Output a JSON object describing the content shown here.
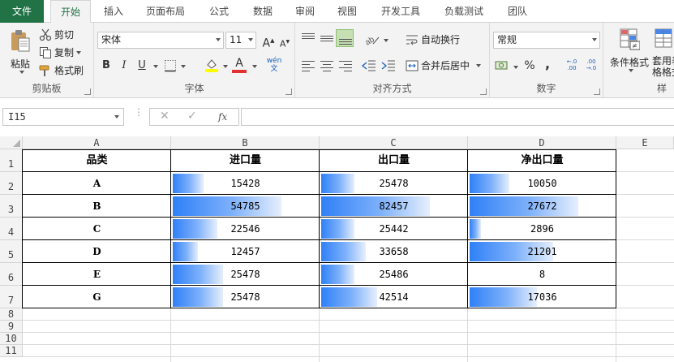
{
  "tabs": [
    "文件",
    "开始",
    "插入",
    "页面布局",
    "公式",
    "数据",
    "审阅",
    "视图",
    "开发工具",
    "负载测试",
    "团队"
  ],
  "active_tab": "开始",
  "ribbon": {
    "clipboard": {
      "label": "剪贴板",
      "paste": "粘贴",
      "cut": "剪切",
      "copy": "复制",
      "format_painter": "格式刷"
    },
    "font": {
      "label": "字体",
      "font_name": "宋体",
      "font_size": "11",
      "bold": "B",
      "italic": "I",
      "underline": "U",
      "grow": "A",
      "shrink": "A",
      "phonetic": "wén 文",
      "font_color_label": "A"
    },
    "alignment": {
      "label": "对齐方式",
      "wrap_text": "自动换行",
      "merge_center": "合并后居中"
    },
    "number": {
      "label": "数字",
      "format": "常规",
      "percent": "%",
      "comma": ",",
      "inc_decimal": "←.0 .00",
      "dec_decimal": ".00 →.0"
    },
    "styles": {
      "conditional_formatting": "条件格式",
      "table_format": "套用表格格式",
      "label": "样"
    }
  },
  "formula_bar": {
    "name_box": "I15",
    "fx": "fx",
    "cancel": "✕",
    "enter": "✓",
    "content": ""
  },
  "grid": {
    "columns": [
      "A",
      "B",
      "C",
      "D",
      "E"
    ],
    "rows": [
      "1",
      "2",
      "3",
      "4",
      "5",
      "6",
      "7",
      "8",
      "9",
      "10",
      "11"
    ],
    "headers": [
      "品类",
      "进口量",
      "出口量",
      "净出口量"
    ],
    "data": [
      [
        "A",
        15428,
        25478,
        10050
      ],
      [
        "B",
        54785,
        82457,
        27672
      ],
      [
        "C",
        22546,
        25442,
        2896
      ],
      [
        "D",
        12457,
        33658,
        21201
      ],
      [
        "E",
        25478,
        25486,
        8
      ],
      [
        "G",
        25478,
        42514,
        17036
      ]
    ],
    "data_bar_color": "#2f80f7"
  }
}
